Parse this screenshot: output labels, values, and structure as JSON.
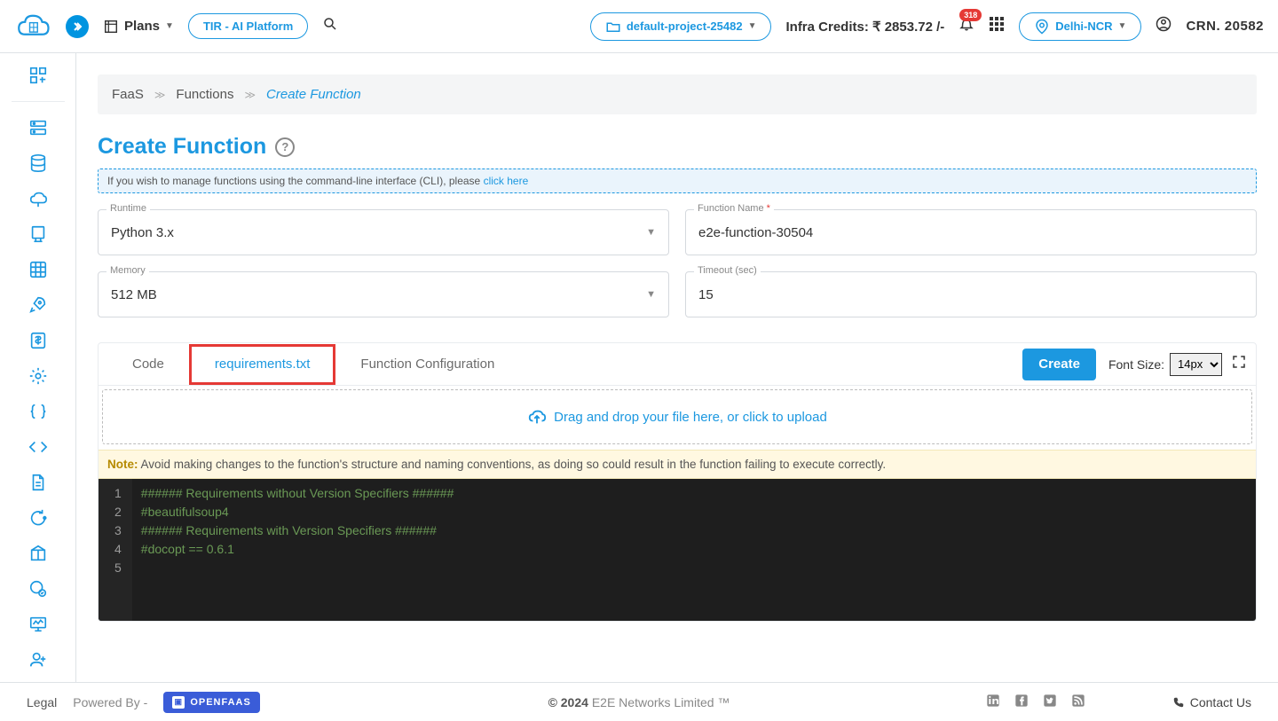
{
  "header": {
    "plans_label": "Plans",
    "tir_label": "TIR - AI Platform",
    "project_label": "default-project-25482",
    "credits_label": "Infra Credits: ₹ 2853.72 /-",
    "notification_count": "318",
    "region": "Delhi-NCR",
    "crn_label": "CRN. 20582"
  },
  "breadcrumb": {
    "level1": "FaaS",
    "level2": "Functions",
    "level3": "Create Function"
  },
  "page": {
    "title": "Create Function",
    "cli_hint_pre": "If you wish to manage functions using the command-line interface (CLI), please ",
    "cli_hint_link": "click here"
  },
  "form": {
    "runtime": {
      "label": "Runtime",
      "value": "Python 3.x"
    },
    "function_name": {
      "label": "Function Name",
      "value": "e2e-function-30504",
      "required": "*"
    },
    "memory": {
      "label": "Memory",
      "value": "512 MB"
    },
    "timeout": {
      "label": "Timeout (sec)",
      "value": "15"
    }
  },
  "tabs": {
    "code": "Code",
    "requirements": "requirements.txt",
    "config": "Function Configuration",
    "create_btn": "Create",
    "fontsize_label": "Font Size:",
    "fontsize_value": "14px"
  },
  "dropzone": {
    "text": "Drag and drop your file here, or click to upload"
  },
  "note": {
    "label": "Note:",
    "text": " Avoid making changes to the function's structure and naming conventions, as doing so could result in the function failing to execute correctly."
  },
  "code_lines": [
    "###### Requirements without Version Specifiers ######",
    "#beautifulsoup4",
    "",
    "###### Requirements with Version Specifiers ######",
    "#docopt == 0.6.1"
  ],
  "footer": {
    "legal": "Legal",
    "powered": "Powered By -",
    "openfaas": "OPENFAAS",
    "copyright": "© 2024",
    "company": " E2E Networks Limited ™",
    "contact": "Contact Us"
  }
}
